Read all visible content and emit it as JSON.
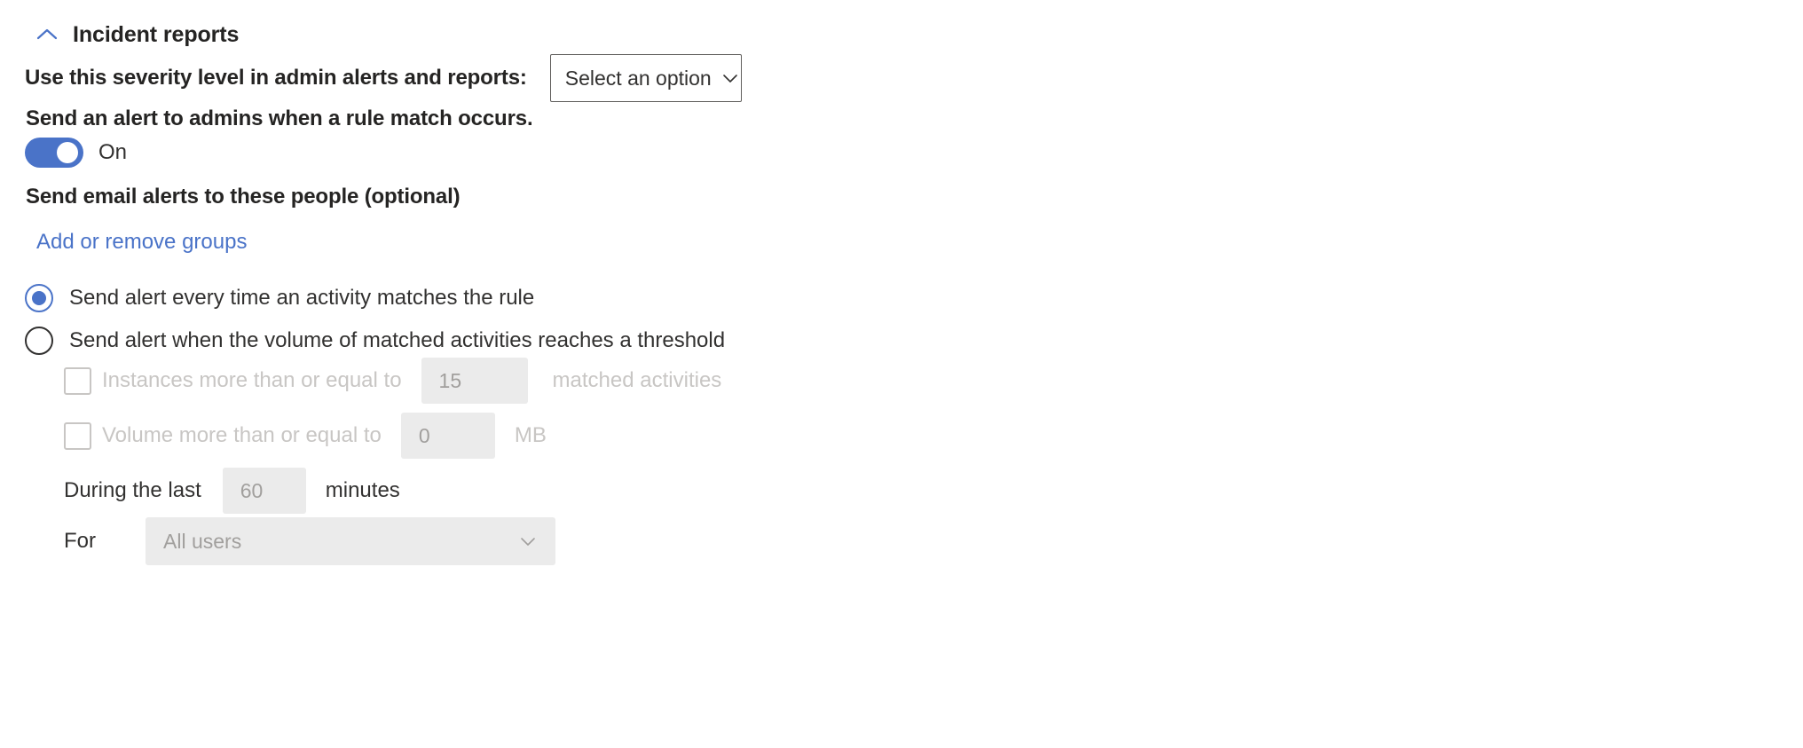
{
  "section": {
    "title": "Incident reports",
    "collapse_icon": "chevron-up-icon",
    "expanded": true
  },
  "severity": {
    "label": "Use this severity level in admin alerts and reports:",
    "dropdown": {
      "value": "Select an option",
      "placeholder": "Select an option",
      "icon": "chevron-down-icon"
    }
  },
  "admin_alert": {
    "label": "Send an alert to admins when a rule match occurs.",
    "toggle": {
      "state_label": "On",
      "checked": true,
      "on_color": "#4a73c8"
    }
  },
  "email_alerts": {
    "label": "Send email alerts to these people (optional)",
    "link_label": "Add or remove groups",
    "link_color": "#4a73c8"
  },
  "alert_mode": {
    "options": [
      {
        "label": "Send alert every time an activity matches the rule",
        "selected": true
      },
      {
        "label": "Send alert when the volume of matched activities reaches a threshold",
        "selected": false
      }
    ]
  },
  "threshold": {
    "disabled": true,
    "instances": {
      "checkbox_label": "Instances more than or equal to",
      "checked": false,
      "value": "15",
      "unit": "matched activities"
    },
    "volume": {
      "checkbox_label": "Volume more than or equal to",
      "checked": false,
      "value": "0",
      "unit": "MB"
    },
    "duration": {
      "label": "During the last",
      "value": "60",
      "unit": "minutes"
    },
    "scope": {
      "label": "For",
      "value": "All users",
      "icon": "chevron-down-icon"
    }
  },
  "colors": {
    "accent": "#4a73c8",
    "text": "#323130",
    "heading": "#252423",
    "disabled_text": "#c8c6c4",
    "field_bg": "#ebebeb"
  }
}
